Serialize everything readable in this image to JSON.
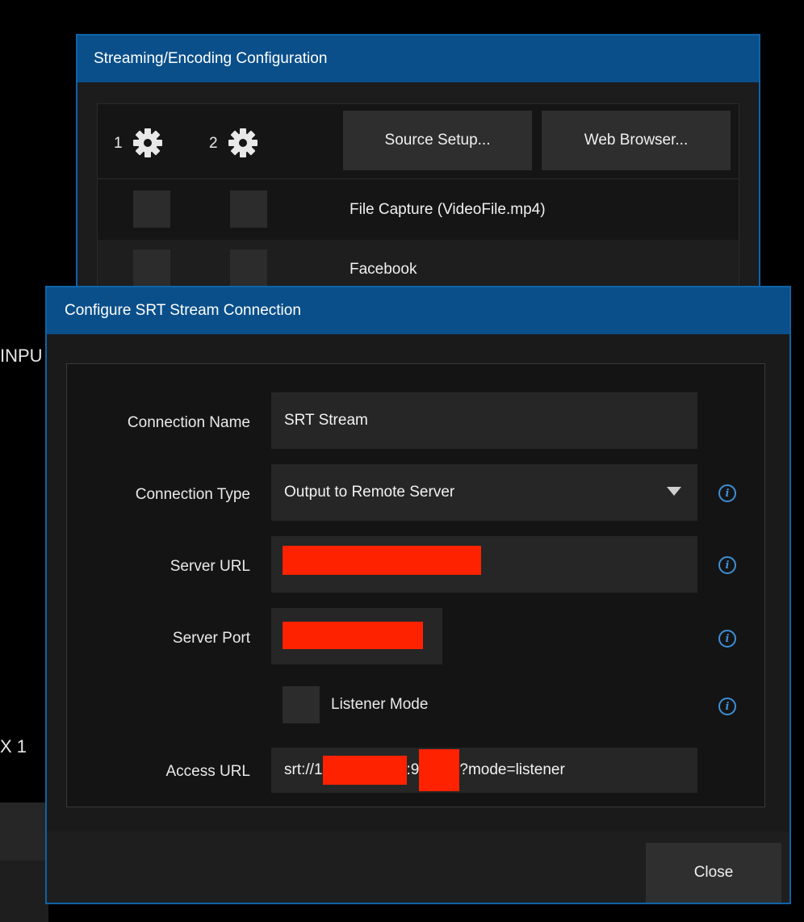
{
  "background": {
    "left_fragment_1": "INPU",
    "left_fragment_2": "X 1"
  },
  "streaming_dialog": {
    "title": "Streaming/Encoding Configuration",
    "encoder_1_label": "1",
    "encoder_2_label": "2",
    "source_setup_label": "Source Setup...",
    "web_browser_label": "Web Browser...",
    "rows": [
      {
        "label": "File Capture (VideoFile.mp4)",
        "enc1_checked": false,
        "enc2_checked": false
      },
      {
        "label": "Facebook",
        "enc1_checked": false,
        "enc2_checked": false
      }
    ]
  },
  "srt_dialog": {
    "title": "Configure SRT Stream Connection",
    "connection_name_label": "Connection Name",
    "connection_name_value": "SRT Stream",
    "connection_type_label": "Connection Type",
    "connection_type_value": "Output to Remote Server",
    "server_url_label": "Server URL",
    "server_port_label": "Server Port",
    "listener_mode_label": "Listener Mode",
    "listener_mode_checked": false,
    "access_url_label": "Access URL",
    "access_url_prefix": "srt://1",
    "access_url_middle": ":9",
    "access_url_suffix": "?mode=listener",
    "info_icon_glyph": "i",
    "close_label": "Close"
  },
  "colors": {
    "title_bar": "#0a4f8a",
    "border_accent": "#0e63a8",
    "info_icon": "#3d8fd6",
    "redaction": "#ff2200"
  }
}
